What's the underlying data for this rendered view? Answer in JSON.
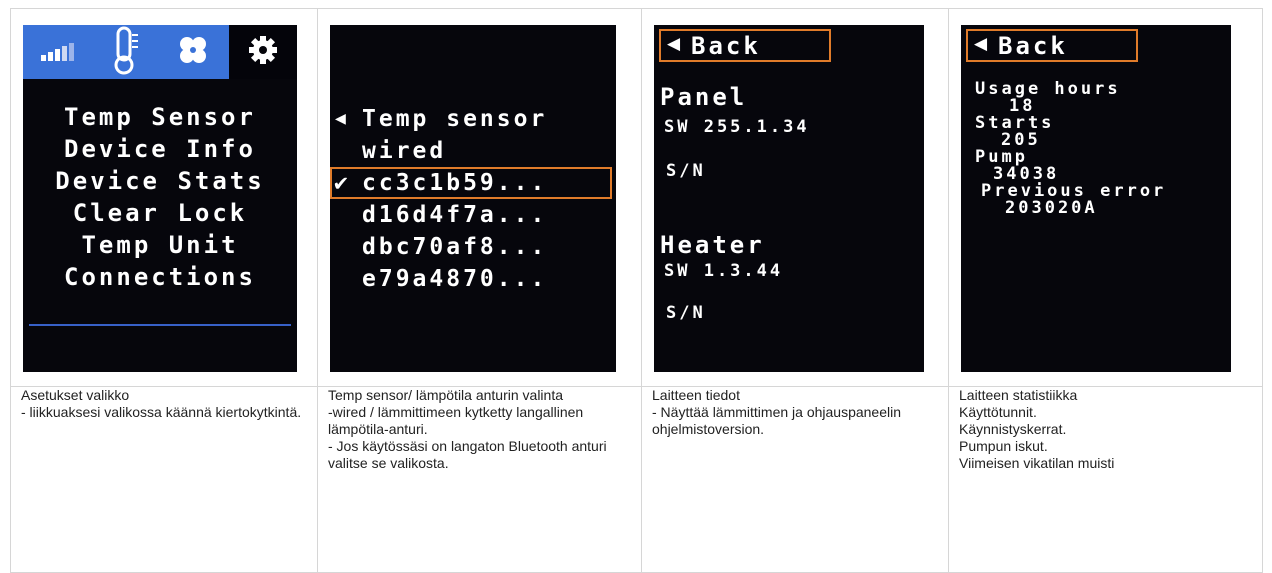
{
  "screens": {
    "menu": {
      "tabs": [
        {
          "icon": "signal-bars-icon"
        },
        {
          "icon": "thermometer-icon"
        },
        {
          "icon": "fan-icon"
        },
        {
          "icon": "gear-icon"
        }
      ],
      "items": [
        "Temp Sensor",
        "Device Info",
        "Device Stats",
        "Clear Lock",
        "Temp Unit",
        "Connections"
      ]
    },
    "sensor": {
      "title": "Temp sensor",
      "options": [
        "wired",
        "cc3c1b59...",
        "d16d4f7a...",
        "dbc70af8...",
        "e79a4870..."
      ],
      "selected_index": 1
    },
    "info": {
      "back": "Back",
      "panel_title": "Panel",
      "panel_sw": "SW 255.1.34",
      "panel_sn": "S/N",
      "heater_title": "Heater",
      "heater_sw": "SW 1.3.44",
      "heater_sn": "S/N"
    },
    "stats": {
      "back": "Back",
      "usage_label": "Usage hours",
      "usage_value": "18",
      "starts_label": "Starts",
      "starts_value": "205",
      "pump_label": "Pump",
      "pump_value": "34038",
      "error_label": "Previous error",
      "error_value": "203020A"
    }
  },
  "captions": [
    "Asetukset valikko\n- liikkuaksesi valikossa käännä kiertokytkintä.",
    "Temp sensor/ lämpötila anturin valinta\n-wired / lämmittimeen kytketty langallinen lämpötila-anturi.\n- Jos käytössäsi on langaton Bluetooth anturi valitse se valikosta.",
    "Laitteen tiedot\n- Näyttää lämmittimen ja ohjauspaneelin ohjelmistoversion.",
    "Laitteen statistiikka\nKäyttötunnit.\nKäynnistyskerrat.\nPumpun iskut.\nViimeisen vikatilan muisti"
  ],
  "colors": {
    "screen_bg": "#06060c",
    "topbar_blue": "#3a72d8",
    "highlight_orange": "#e07b2a",
    "divider_blue": "#3760c8"
  }
}
